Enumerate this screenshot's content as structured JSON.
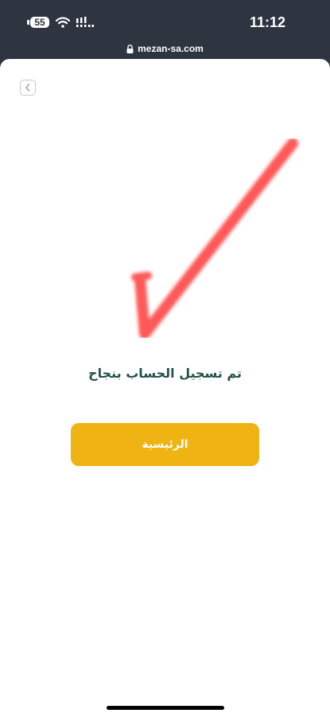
{
  "status_bar": {
    "battery_level": "55",
    "time": "11:12",
    "icons": [
      "battery-icon",
      "wifi-icon",
      "cellular-signal-icon"
    ]
  },
  "browser": {
    "url": "mezan-sa.com",
    "icons": [
      "lock-icon"
    ]
  },
  "page": {
    "back_icon": "chevron-left-icon",
    "success_icon": "checkmark-icon",
    "success_color": "#ff3b3b",
    "success_message": "تم تسجيل الحساب بنجاح",
    "home_button_label": "الرئيسية",
    "accent_color": "#efb413",
    "message_color": "#24524a"
  }
}
